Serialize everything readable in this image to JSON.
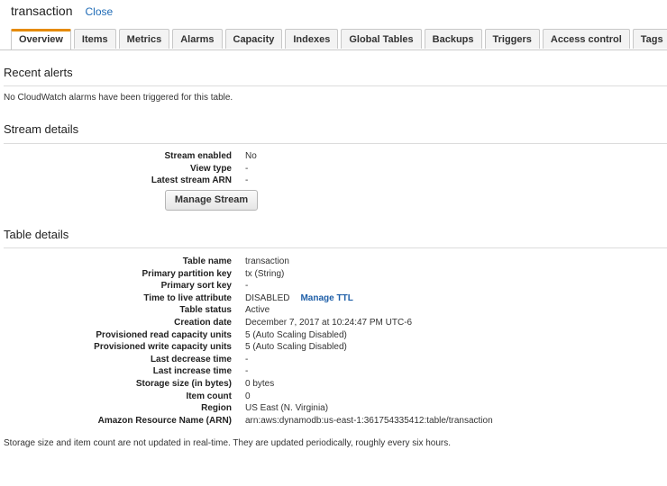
{
  "header": {
    "title": "transaction",
    "close_label": "Close"
  },
  "tabs": [
    {
      "label": "Overview",
      "active": true
    },
    {
      "label": "Items"
    },
    {
      "label": "Metrics"
    },
    {
      "label": "Alarms"
    },
    {
      "label": "Capacity"
    },
    {
      "label": "Indexes"
    },
    {
      "label": "Global Tables"
    },
    {
      "label": "Backups"
    },
    {
      "label": "Triggers"
    },
    {
      "label": "Access control"
    },
    {
      "label": "Tags"
    }
  ],
  "recent_alerts": {
    "title": "Recent alerts",
    "message": "No CloudWatch alarms have been triggered for this table."
  },
  "stream_details": {
    "title": "Stream details",
    "rows": [
      {
        "label": "Stream enabled",
        "value": "No"
      },
      {
        "label": "View type",
        "value": "-"
      },
      {
        "label": "Latest stream ARN",
        "value": "-"
      }
    ],
    "button_label": "Manage Stream"
  },
  "table_details": {
    "title": "Table details",
    "rows": [
      {
        "label": "Table name",
        "value": "transaction"
      },
      {
        "label": "Primary partition key",
        "value": "tx (String)"
      },
      {
        "label": "Primary sort key",
        "value": "-"
      },
      {
        "label": "Time to live attribute",
        "value": "DISABLED",
        "link": "Manage TTL"
      },
      {
        "label": "Table status",
        "value": "Active"
      },
      {
        "label": "Creation date",
        "value": "December 7, 2017 at 10:24:47 PM UTC-6"
      },
      {
        "label": "Provisioned read capacity units",
        "value": "5 (Auto Scaling Disabled)"
      },
      {
        "label": "Provisioned write capacity units",
        "value": "5 (Auto Scaling Disabled)"
      },
      {
        "label": "Last decrease time",
        "value": "-"
      },
      {
        "label": "Last increase time",
        "value": "-"
      },
      {
        "label": "Storage size (in bytes)",
        "value": "0 bytes"
      },
      {
        "label": "Item count",
        "value": "0"
      },
      {
        "label": "Region",
        "value": "US East (N. Virginia)"
      },
      {
        "label": "Amazon Resource Name (ARN)",
        "value": "arn:aws:dynamodb:us-east-1:361754335412:table/transaction"
      }
    ]
  },
  "footer_note": "Storage size and item count are not updated in real-time. They are updated periodically, roughly every six hours."
}
